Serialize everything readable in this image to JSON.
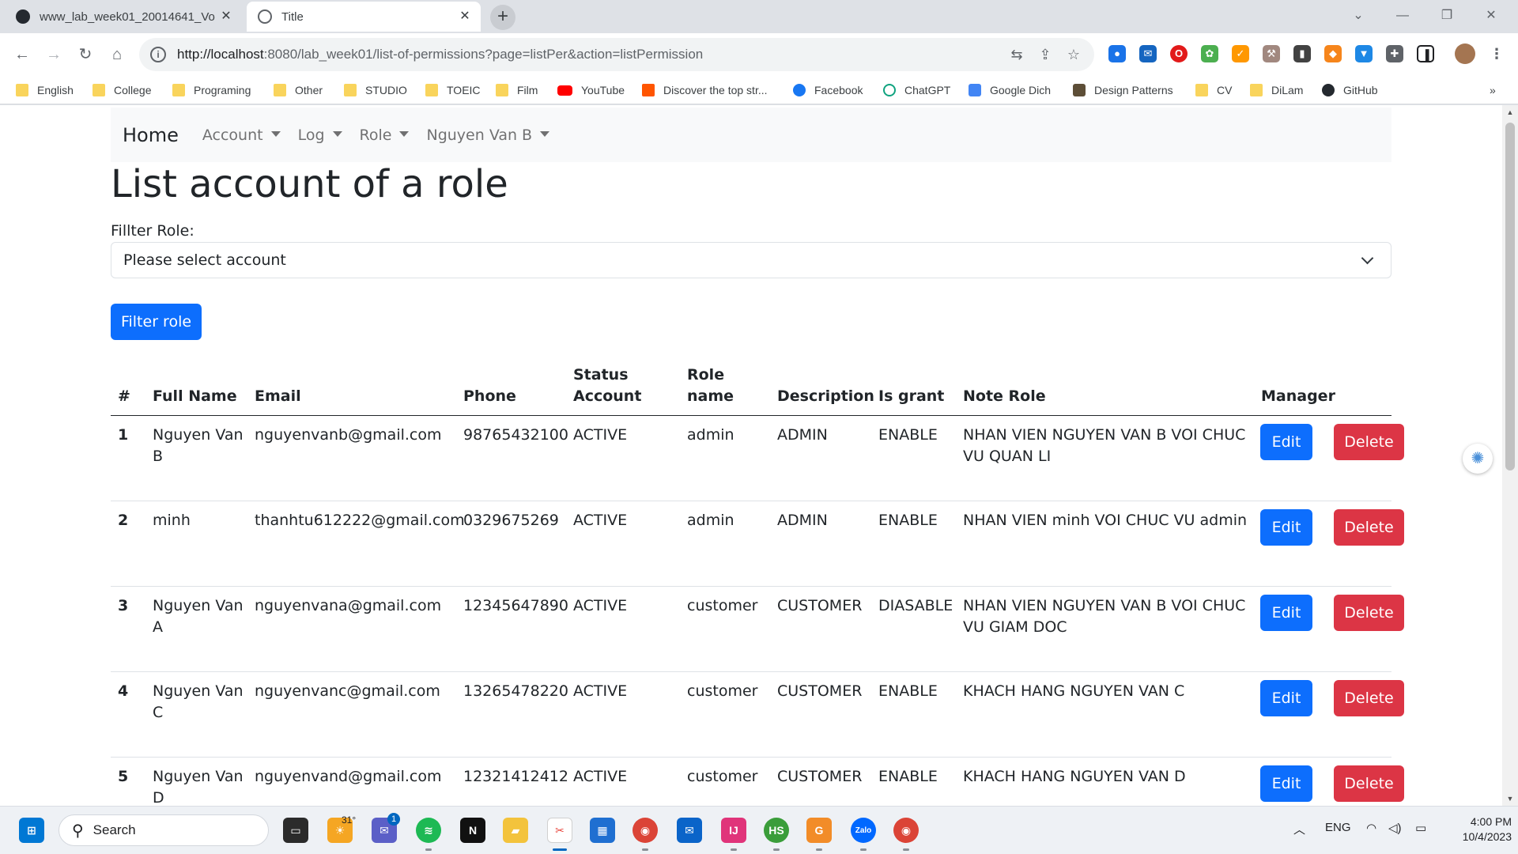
{
  "browser": {
    "tabs": [
      {
        "title": "www_lab_week01_20014641_Vo",
        "active": false
      },
      {
        "title": "Title",
        "active": true
      }
    ],
    "new_tab": "+",
    "url_host": "http://localhost",
    "url_rest": ":8080/lab_week01/list-of-permissions?page=listPer&action=listPermission",
    "bookmarks": [
      "English",
      "College",
      "Programing",
      "Other",
      "STUDIO",
      "TOEIC",
      "Film",
      "YouTube",
      "Discover the top str...",
      "Facebook",
      "ChatGPT",
      "Google Dich",
      "Design Patterns",
      "CV",
      "DiLam",
      "GitHub"
    ],
    "bookmarks_more": "»"
  },
  "navbar": {
    "brand": "Home",
    "items": [
      "Account",
      "Log",
      "Role",
      "Nguyen Van B"
    ]
  },
  "page": {
    "title": "List account of a role",
    "filter_label": "Fillter Role:",
    "select_value": "Please select account",
    "filter_button": "Filter role"
  },
  "table": {
    "headers": [
      "#",
      "Full Name",
      "Email",
      "Phone",
      "Status Account",
      "Role name",
      "Description",
      "Is grant",
      "Note Role",
      "Manager"
    ],
    "edit_label": "Edit",
    "delete_label": "Delete",
    "rows": [
      {
        "id": "1",
        "full_name": "Nguyen Van B",
        "email": "nguyenvanb@gmail.com",
        "phone": "98765432100",
        "status": "ACTIVE",
        "role": "admin",
        "description": "ADMIN",
        "grant": "ENABLE",
        "note": "NHAN VIEN NGUYEN VAN B VOI CHUC VU QUAN LI"
      },
      {
        "id": "2",
        "full_name": "minh",
        "email": "thanhtu612222@gmail.com",
        "phone": "0329675269",
        "status": "ACTIVE",
        "role": "admin",
        "description": "ADMIN",
        "grant": "ENABLE",
        "note": "NHAN VIEN minh VOI CHUC VU admin"
      },
      {
        "id": "3",
        "full_name": "Nguyen Van A",
        "email": "nguyenvana@gmail.com",
        "phone": "12345647890",
        "status": "ACTIVE",
        "role": "customer",
        "description": "CUSTOMER",
        "grant": "DIASABLE",
        "note": "NHAN VIEN NGUYEN VAN B VOI CHUC VU GIAM DOC"
      },
      {
        "id": "4",
        "full_name": "Nguyen Van C",
        "email": "nguyenvanc@gmail.com",
        "phone": "13265478220",
        "status": "ACTIVE",
        "role": "customer",
        "description": "CUSTOMER",
        "grant": "ENABLE",
        "note": "KHACH HANG NGUYEN VAN C"
      },
      {
        "id": "5",
        "full_name": "Nguyen Van D",
        "email": "nguyenvand@gmail.com",
        "phone": "12321412412",
        "status": "ACTIVE",
        "role": "customer",
        "description": "CUSTOMER",
        "grant": "ENABLE",
        "note": "KHACH HANG NGUYEN VAN D"
      }
    ]
  },
  "taskbar": {
    "search_placeholder": "Search",
    "weather_temp": "31°",
    "chat_badge": "1",
    "language": "ENG",
    "time": "4:00 PM",
    "date": "10/4/2023"
  },
  "colors": {
    "primary": "#0d6efd",
    "danger": "#dc3545",
    "navbar_bg": "#f8f9fa"
  }
}
